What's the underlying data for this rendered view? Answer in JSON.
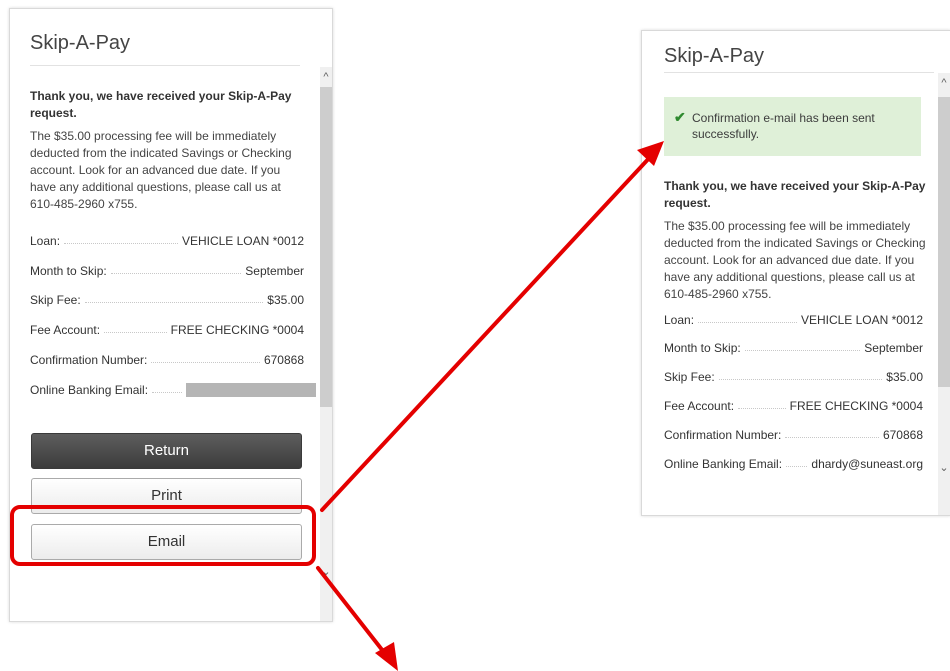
{
  "left": {
    "title": "Skip-A-Pay",
    "heading": "Thank you, we have received your Skip-A-Pay request.",
    "body": "The $35.00 processing fee will be immediately deducted from the indicated Savings or Checking account. Look for an advanced due date. If you have any additional questions, please call us at 610-485-2960 x755.",
    "rows": [
      {
        "label": "Loan:",
        "value": "VEHICLE LOAN *0012"
      },
      {
        "label": "Month to Skip:",
        "value": "September"
      },
      {
        "label": "Skip Fee:",
        "value": "$35.00"
      },
      {
        "label": "Fee Account:",
        "value": "FREE CHECKING *0004"
      },
      {
        "label": "Confirmation Number:",
        "value": "670868"
      },
      {
        "label": "Online Banking Email:",
        "value": ""
      }
    ],
    "buttons": {
      "return": "Return",
      "print": "Print",
      "email": "Email"
    }
  },
  "right": {
    "title": "Skip-A-Pay",
    "success": "Confirmation e-mail has been sent successfully.",
    "heading": "Thank you, we have received your Skip-A-Pay request.",
    "body": "The $35.00 processing fee will be immediately deducted from the indicated Savings or Checking account. Look for an advanced due date. If you have any additional questions, please call us at 610-485-2960 x755.",
    "rows": [
      {
        "label": "Loan:",
        "value": "VEHICLE LOAN *0012"
      },
      {
        "label": "Month to Skip:",
        "value": "September"
      },
      {
        "label": "Skip Fee:",
        "value": "$35.00"
      },
      {
        "label": "Fee Account:",
        "value": "FREE CHECKING *0004"
      },
      {
        "label": "Confirmation Number:",
        "value": "670868"
      },
      {
        "label": "Online Banking Email:",
        "value": "dhardy@suneast.org"
      }
    ]
  },
  "icons": {
    "success": "checkmark-icon",
    "scroll_up": "chevron-up-icon",
    "scroll_down": "chevron-down-icon"
  },
  "colors": {
    "annotation": "#e40000",
    "success_bg": "#dff0d8",
    "primary_button": "#4a4a4a"
  }
}
